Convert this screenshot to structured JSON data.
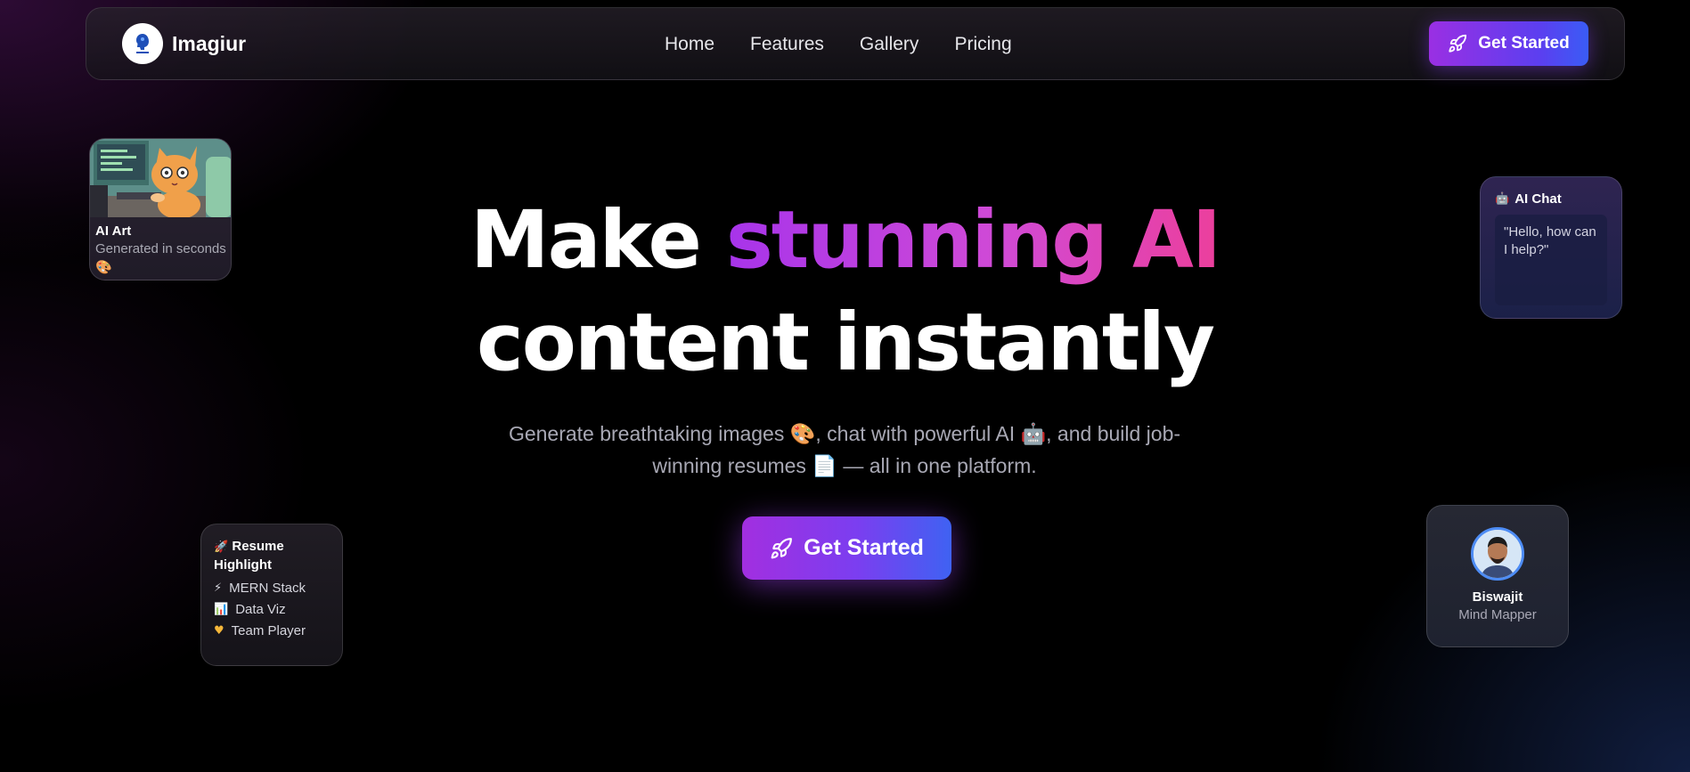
{
  "nav": {
    "brand": "Imagiur",
    "links": [
      "Home",
      "Features",
      "Gallery",
      "Pricing"
    ],
    "cta": "Get Started"
  },
  "hero": {
    "title_line1_plain": "Make ",
    "title_line1_gradient": "stunning AI",
    "title_line2": "content instantly",
    "subtitle_part1": "Generate breathtaking images ",
    "subtitle_part2": ", chat with powerful AI ",
    "subtitle_part3": ", and build job-winning resumes ",
    "subtitle_part4": " — all in one platform.",
    "cta": "Get Started"
  },
  "cards": {
    "art": {
      "title": "AI Art",
      "subtitle": "Generated in seconds"
    },
    "chat": {
      "title": "AI Chat",
      "message": "\"Hello, how can I help?\""
    },
    "resume": {
      "title": "Resume Highlight",
      "items": [
        "MERN Stack",
        "Data Viz",
        "Team Player"
      ]
    },
    "profile": {
      "name": "Biswajit",
      "role": "Mind Mapper"
    }
  },
  "colors": {
    "accent_purple": "#9a2fe3",
    "accent_blue": "#3a5cf5",
    "accent_pink": "#ec3f9c",
    "background": "#000000"
  },
  "icons": [
    "rocket-icon",
    "palette-icon",
    "robot-icon",
    "document-icon",
    "lightning-icon",
    "chart-icon",
    "heart-icon"
  ]
}
